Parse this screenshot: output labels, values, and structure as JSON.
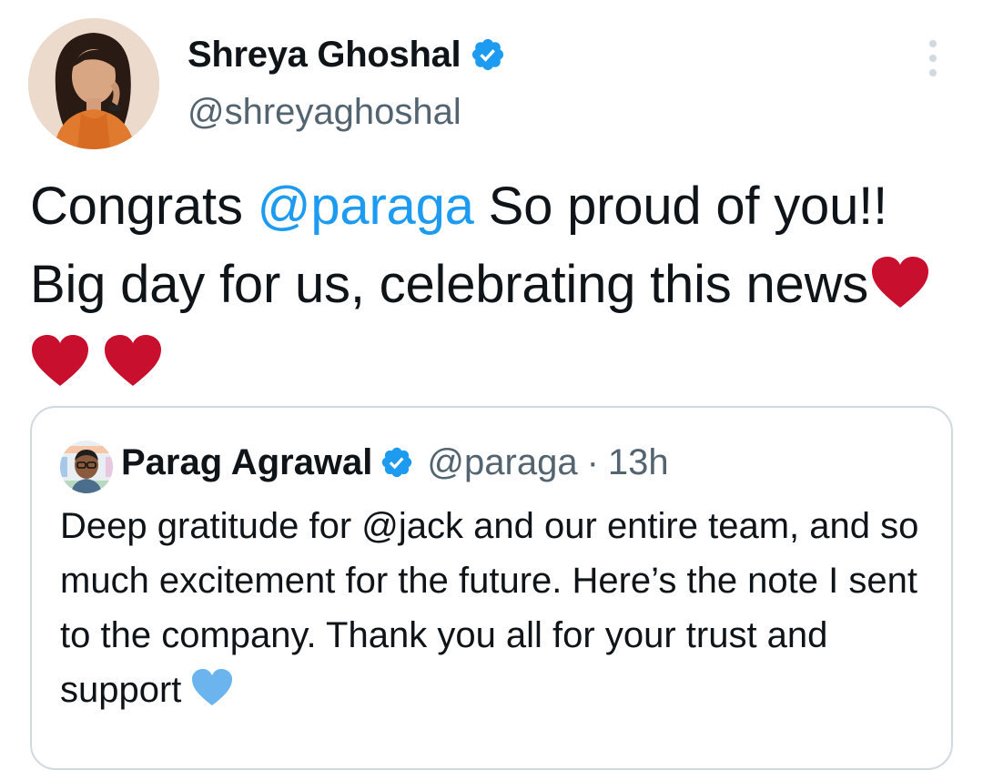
{
  "tweet": {
    "author": {
      "display_name": "Shreya Ghoshal",
      "handle": "@shreyaghoshal",
      "verified": true
    },
    "text": {
      "part1": "Congrats ",
      "mention": "@paraga",
      "part2": " So proud of you!! Big day for us, celebrating this news",
      "emoji": [
        "red-heart",
        "red-heart",
        "red-heart"
      ]
    }
  },
  "quoted_tweet": {
    "author": {
      "display_name": "Parag Agrawal",
      "handle": "@paraga",
      "verified": true
    },
    "separator": "·",
    "time": "13h",
    "text": "Deep gratitude for @jack and our entire team, and so much excitement for the future. Here’s the note I sent to the company. Thank you all for your trust and support",
    "emoji": "blue-heart"
  },
  "colors": {
    "accent": "#1d9bf0",
    "text": "#0f1419",
    "secondary": "#536471",
    "border": "#cfd9de",
    "red_heart": "#c8102e",
    "blue_heart": "#6cb4ee"
  },
  "icons": {
    "verified": "verified-badge-icon",
    "more": "more-options-icon"
  }
}
